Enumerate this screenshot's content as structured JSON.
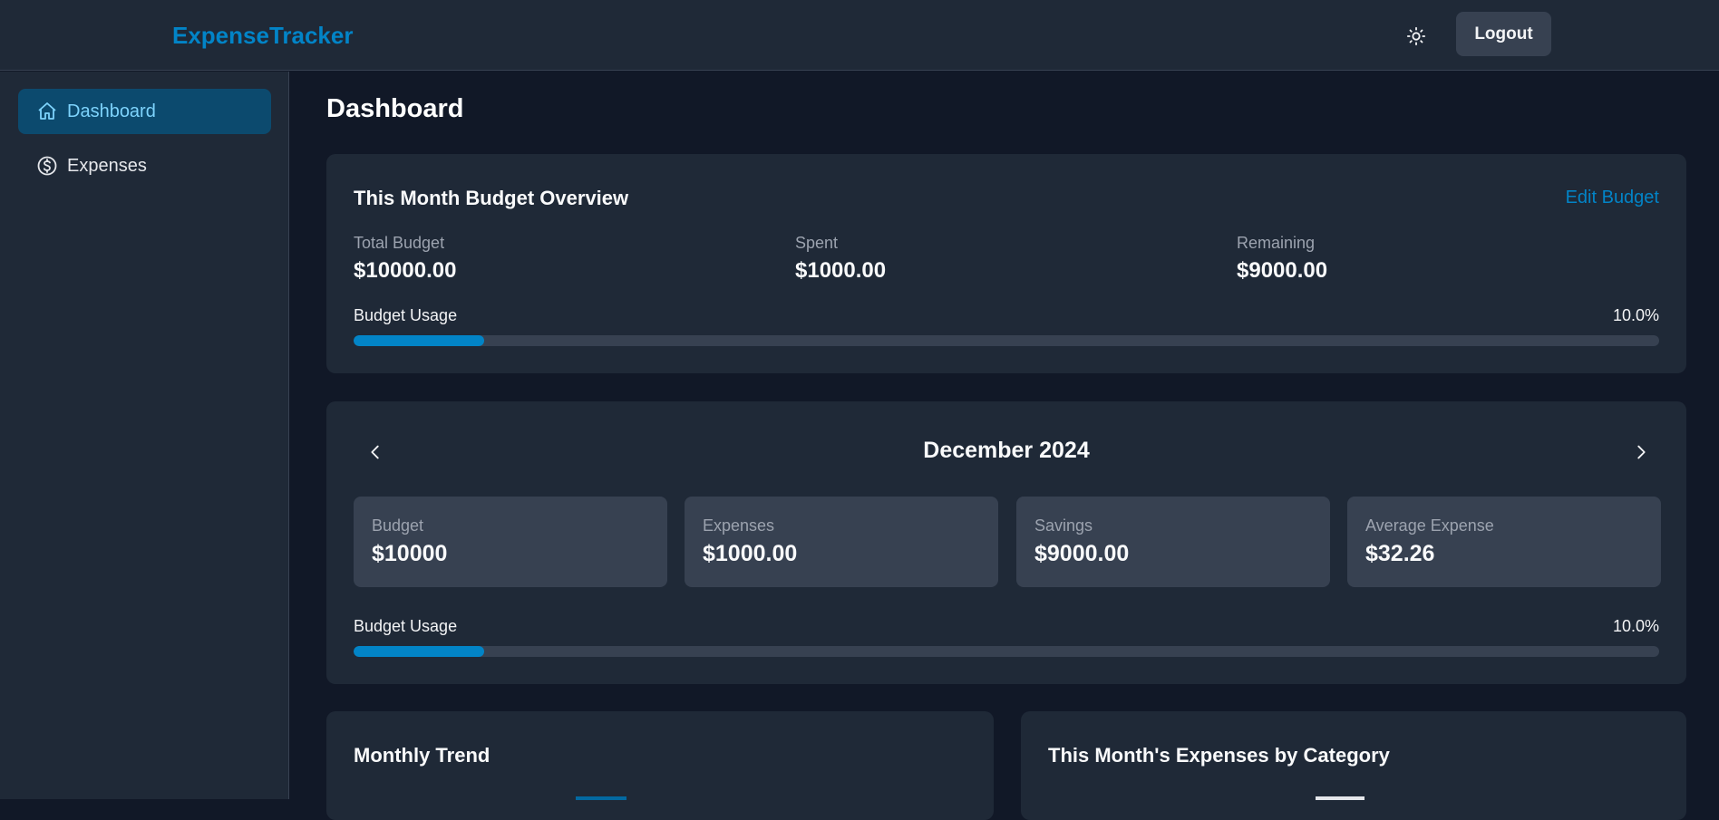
{
  "header": {
    "brand": "ExpenseTracker",
    "theme_icon": "sun-icon",
    "logout_label": "Logout"
  },
  "sidebar": {
    "items": [
      {
        "label": "Dashboard",
        "icon": "home-icon",
        "active": true
      },
      {
        "label": "Expenses",
        "icon": "dollar-circle-icon",
        "active": false
      }
    ]
  },
  "main": {
    "title": "Dashboard",
    "overview": {
      "title": "This Month Budget Overview",
      "edit_label": "Edit Budget",
      "stats": [
        {
          "label": "Total Budget",
          "value": "$10000.00"
        },
        {
          "label": "Spent",
          "value": "$1000.00"
        },
        {
          "label": "Remaining",
          "value": "$9000.00"
        }
      ],
      "usage_label": "Budget Usage",
      "usage_pct": "10.0%",
      "usage_fraction": 0.1
    },
    "monthly": {
      "month": "December 2024",
      "prev_icon": "chevron-left-icon",
      "next_icon": "chevron-right-icon",
      "cards": [
        {
          "label": "Budget",
          "value": "$10000"
        },
        {
          "label": "Expenses",
          "value": "$1000.00"
        },
        {
          "label": "Savings",
          "value": "$9000.00"
        },
        {
          "label": "Average Expense",
          "value": "$32.26"
        }
      ],
      "usage_label": "Budget Usage",
      "usage_pct": "10.0%",
      "usage_fraction": 0.1
    },
    "trend": {
      "title": "Monthly Trend"
    },
    "category": {
      "title": "This Month's Expenses by Category"
    }
  },
  "colors": {
    "accent": "#0284c7",
    "background": "#111827",
    "panel": "#1f2937",
    "active_nav_bg": "#0c4a6e",
    "active_nav_text": "#7dd3fc"
  }
}
